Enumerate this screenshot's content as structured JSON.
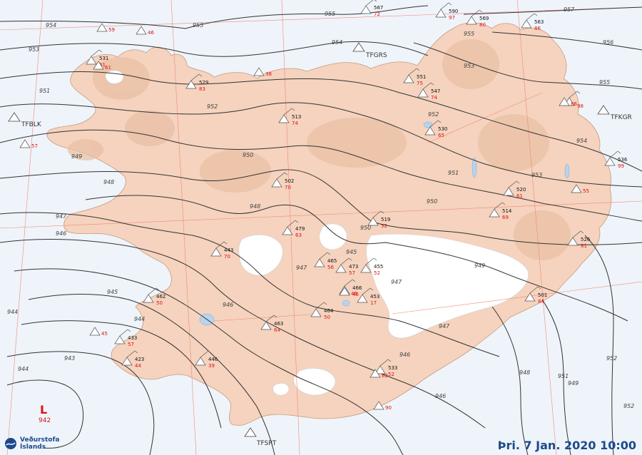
{
  "map": {
    "low_center": {
      "symbol": "L",
      "pressure": "942"
    },
    "stations": [
      {
        "id": "TFBLK",
        "label": "TFBLK"
      },
      {
        "id": "TFGRS",
        "label": "TFGRS"
      },
      {
        "id": "TFKGR",
        "label": "TFKGR"
      },
      {
        "id": "TFSRT",
        "label": "TFSRT"
      }
    ],
    "isobars": [
      "955",
      "954",
      "953",
      "952",
      "951",
      "950",
      "949",
      "948",
      "947",
      "946",
      "945",
      "944",
      "943",
      "942",
      "957",
      "956"
    ],
    "obs": [
      {
        "p": "551",
        "t": "75"
      },
      {
        "p": "547",
        "t": "74"
      },
      {
        "p": "513",
        "t": "74"
      },
      {
        "p": "502",
        "t": "70"
      },
      {
        "p": "479",
        "t": "63"
      },
      {
        "p": "443",
        "t": "70"
      },
      {
        "p": "465",
        "t": "56"
      },
      {
        "p": "473",
        "t": "57"
      },
      {
        "p": "455",
        "t": "52"
      },
      {
        "p": "466",
        "t": "46"
      },
      {
        "p": "453",
        "t": "17"
      },
      {
        "p": "464",
        "t": "50"
      },
      {
        "p": "463",
        "t": "64"
      },
      {
        "p": "433",
        "t": "57"
      },
      {
        "p": "423",
        "t": "44"
      },
      {
        "p": "446",
        "t": "39"
      },
      {
        "p": "519",
        "t": "52"
      },
      {
        "p": "520",
        "t": "61"
      },
      {
        "p": "526",
        "t": "81"
      },
      {
        "p": "536",
        "t": "99"
      },
      {
        "p": "501",
        "t": "84"
      },
      {
        "p": "530",
        "t": "65"
      },
      {
        "p": "462",
        "t": "50"
      },
      {
        "p": "533",
        "t": "52"
      },
      {
        "p": "567",
        "t": "72"
      },
      {
        "p": "590",
        "t": "97"
      },
      {
        "p": "569",
        "t": "80"
      },
      {
        "p": "563",
        "t": "86"
      },
      {
        "p": "531",
        "t": "61"
      },
      {
        "p": "529",
        "t": "83"
      },
      {
        "p": "514",
        "t": "69"
      },
      {
        "p": "",
        "t": "98"
      }
    ],
    "extra_red": [
      "59",
      "46",
      "61",
      "57",
      "38",
      "45",
      "55",
      "86",
      "46",
      "62",
      "90"
    ]
  },
  "footer": {
    "date_time": "Þri. 7 Jan. 2020 10:00",
    "logo_line1": "Veðurstofa",
    "logo_line2": "Íslands"
  },
  "colors": {
    "sea": "#eef4fa",
    "land": "#f5d3be",
    "ice": "#ffffff",
    "isobar": "#333333",
    "graticule": "#f08a7a",
    "brand": "#1d4a8c",
    "temp_red": "#d11111"
  }
}
